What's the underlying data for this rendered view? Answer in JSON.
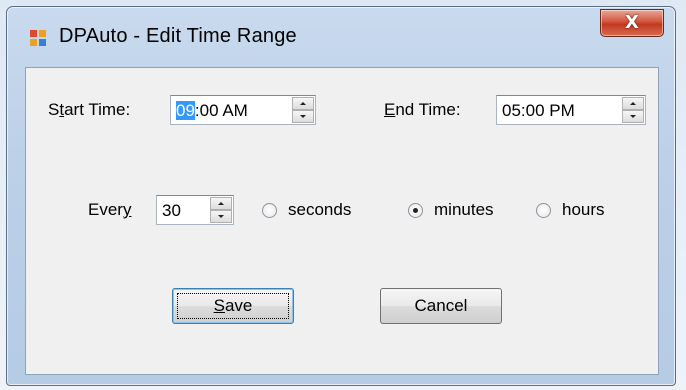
{
  "window": {
    "title": "DPAuto - Edit Time Range",
    "close_glyph": "X",
    "icon": "app-icon"
  },
  "form": {
    "start_time": {
      "label_prefix": "S",
      "label_accel": "t",
      "label_rest": "art Time:",
      "value_selected": "09",
      "value_rest": ":00 AM"
    },
    "end_time": {
      "label_accel": "E",
      "label_rest": "nd Time:",
      "value": "05:00 PM"
    },
    "every": {
      "label_prefix": "Ever",
      "label_accel": "y",
      "value": "30"
    },
    "units": [
      {
        "label": "seconds",
        "checked": false
      },
      {
        "label": "minutes",
        "checked": true
      },
      {
        "label": "hours",
        "checked": false
      }
    ]
  },
  "buttons": {
    "save_accel": "S",
    "save_rest": "ave",
    "cancel": "Cancel"
  },
  "colors": {
    "selection": "#3399ff",
    "close_button": "#c23a22",
    "client_bg": "#f0f0f0"
  }
}
